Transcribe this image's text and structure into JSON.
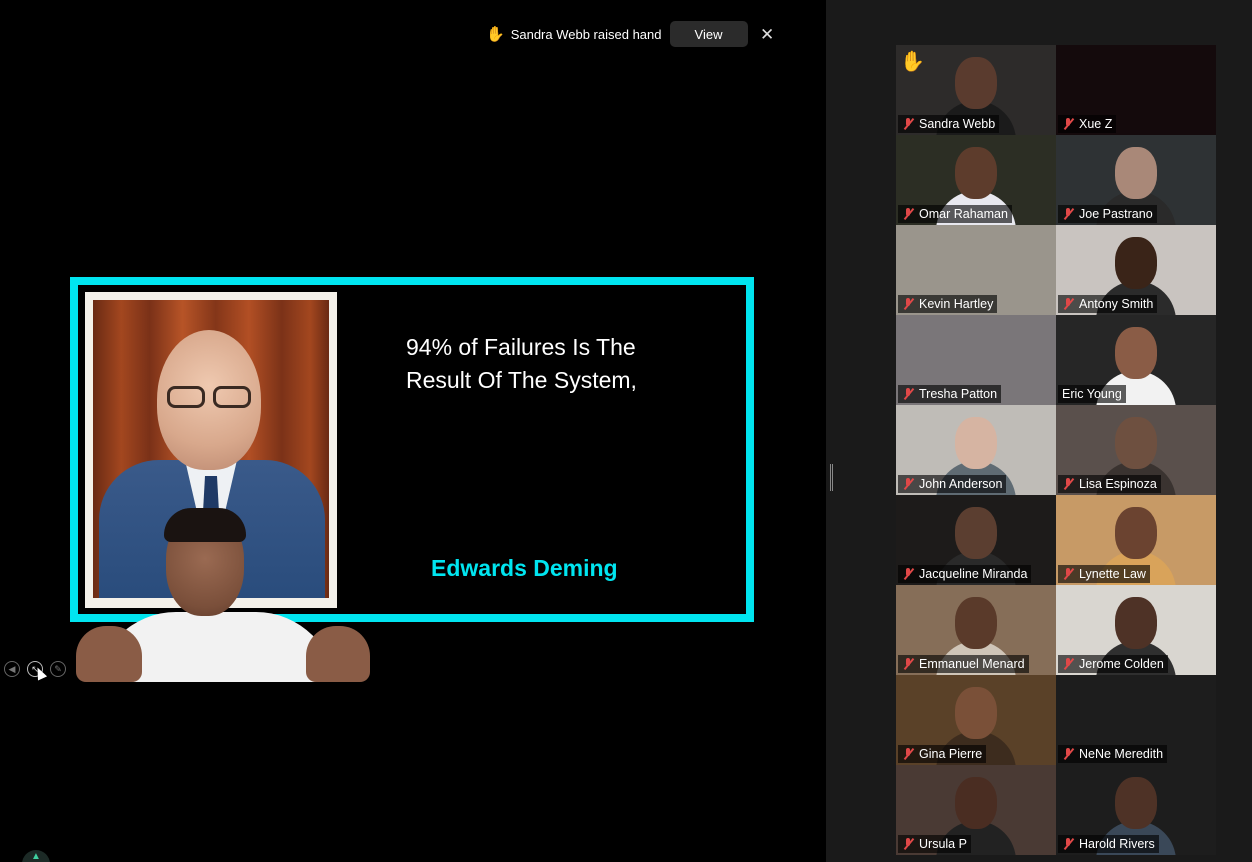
{
  "notification": {
    "hand_icon": "✋",
    "text": "Sandra Webb raised hand",
    "view_label": "View",
    "close_icon": "✕"
  },
  "slide": {
    "quote": "94% of Failures Is The Result Of The System,",
    "author": "Edwards Deming",
    "accent_color": "#00e5f0"
  },
  "slide_nav": {
    "prev_icon": "◀",
    "pointer_icon": "↖",
    "pen_icon": "✎"
  },
  "bottom_control": {
    "icon": "▲"
  },
  "participants": [
    {
      "name": "Sandra Webb",
      "muted": true,
      "raised_hand": true,
      "bg": "#2d2b2a",
      "skin": "#5a3b2e",
      "shirt": "#1b1b1b"
    },
    {
      "name": "Xue Z",
      "muted": true,
      "bg": "#140a0c",
      "skin": "",
      "shirt": ""
    },
    {
      "name": "Omar Rahaman",
      "muted": true,
      "bg": "#2c2e24",
      "skin": "#5d3c2c",
      "shirt": "#e8e8ef"
    },
    {
      "name": "Joe Pastrano",
      "muted": true,
      "bg": "#2e3234",
      "skin": "#a98878",
      "shirt": "#2a2a2a"
    },
    {
      "name": "Kevin Hartley",
      "muted": true,
      "bg": "#9a958c",
      "skin": "",
      "shirt": ""
    },
    {
      "name": "Antony Smith",
      "muted": true,
      "bg": "#c9c4c0",
      "skin": "#3a2418",
      "shirt": "#2b2b2b"
    },
    {
      "name": "Tresha Patton",
      "muted": true,
      "bg": "#7a7679",
      "skin": "",
      "shirt": ""
    },
    {
      "name": "Eric Young",
      "muted": false,
      "active": true,
      "bg": "#262626",
      "skin": "#8a5c46",
      "shirt": "#f2f2f2"
    },
    {
      "name": "John Anderson",
      "muted": true,
      "bg": "#bfbcb7",
      "skin": "#d6b4a2",
      "shirt": "#5f6b73"
    },
    {
      "name": "Lisa Espinoza",
      "muted": true,
      "bg": "#5a504c",
      "skin": "#6e5040",
      "shirt": "#3a3330"
    },
    {
      "name": "Jacqueline Miranda",
      "muted": true,
      "bg": "#1d1b1a",
      "skin": "#5b3e30",
      "shirt": "#2a2a2a"
    },
    {
      "name": "Lynette Law",
      "muted": true,
      "bg": "#c79a66",
      "skin": "#6b4330",
      "shirt": "#d9a35a"
    },
    {
      "name": "Emmanuel Menard",
      "muted": true,
      "bg": "#866e58",
      "skin": "#5a3a2a",
      "shirt": "#cfc5b8"
    },
    {
      "name": "Jerome Colden",
      "muted": true,
      "bg": "#d9d6d0",
      "skin": "#4e3226",
      "shirt": "#2f2f2f"
    },
    {
      "name": "Gina Pierre",
      "muted": true,
      "bg": "#5a4128",
      "skin": "#7a5038",
      "shirt": "#3d2c1e"
    },
    {
      "name": "NeNe Meredith",
      "muted": true,
      "bg": "#1d1d1d",
      "skin": "",
      "shirt": ""
    },
    {
      "name": "Ursula P",
      "muted": true,
      "bg": "#4a3a34",
      "skin": "#4a2d22",
      "shirt": "#222"
    },
    {
      "name": "Harold Rivers",
      "muted": true,
      "bg": "#1d1d1d",
      "skin": "#4e3226",
      "shirt": "#3a4858"
    }
  ]
}
